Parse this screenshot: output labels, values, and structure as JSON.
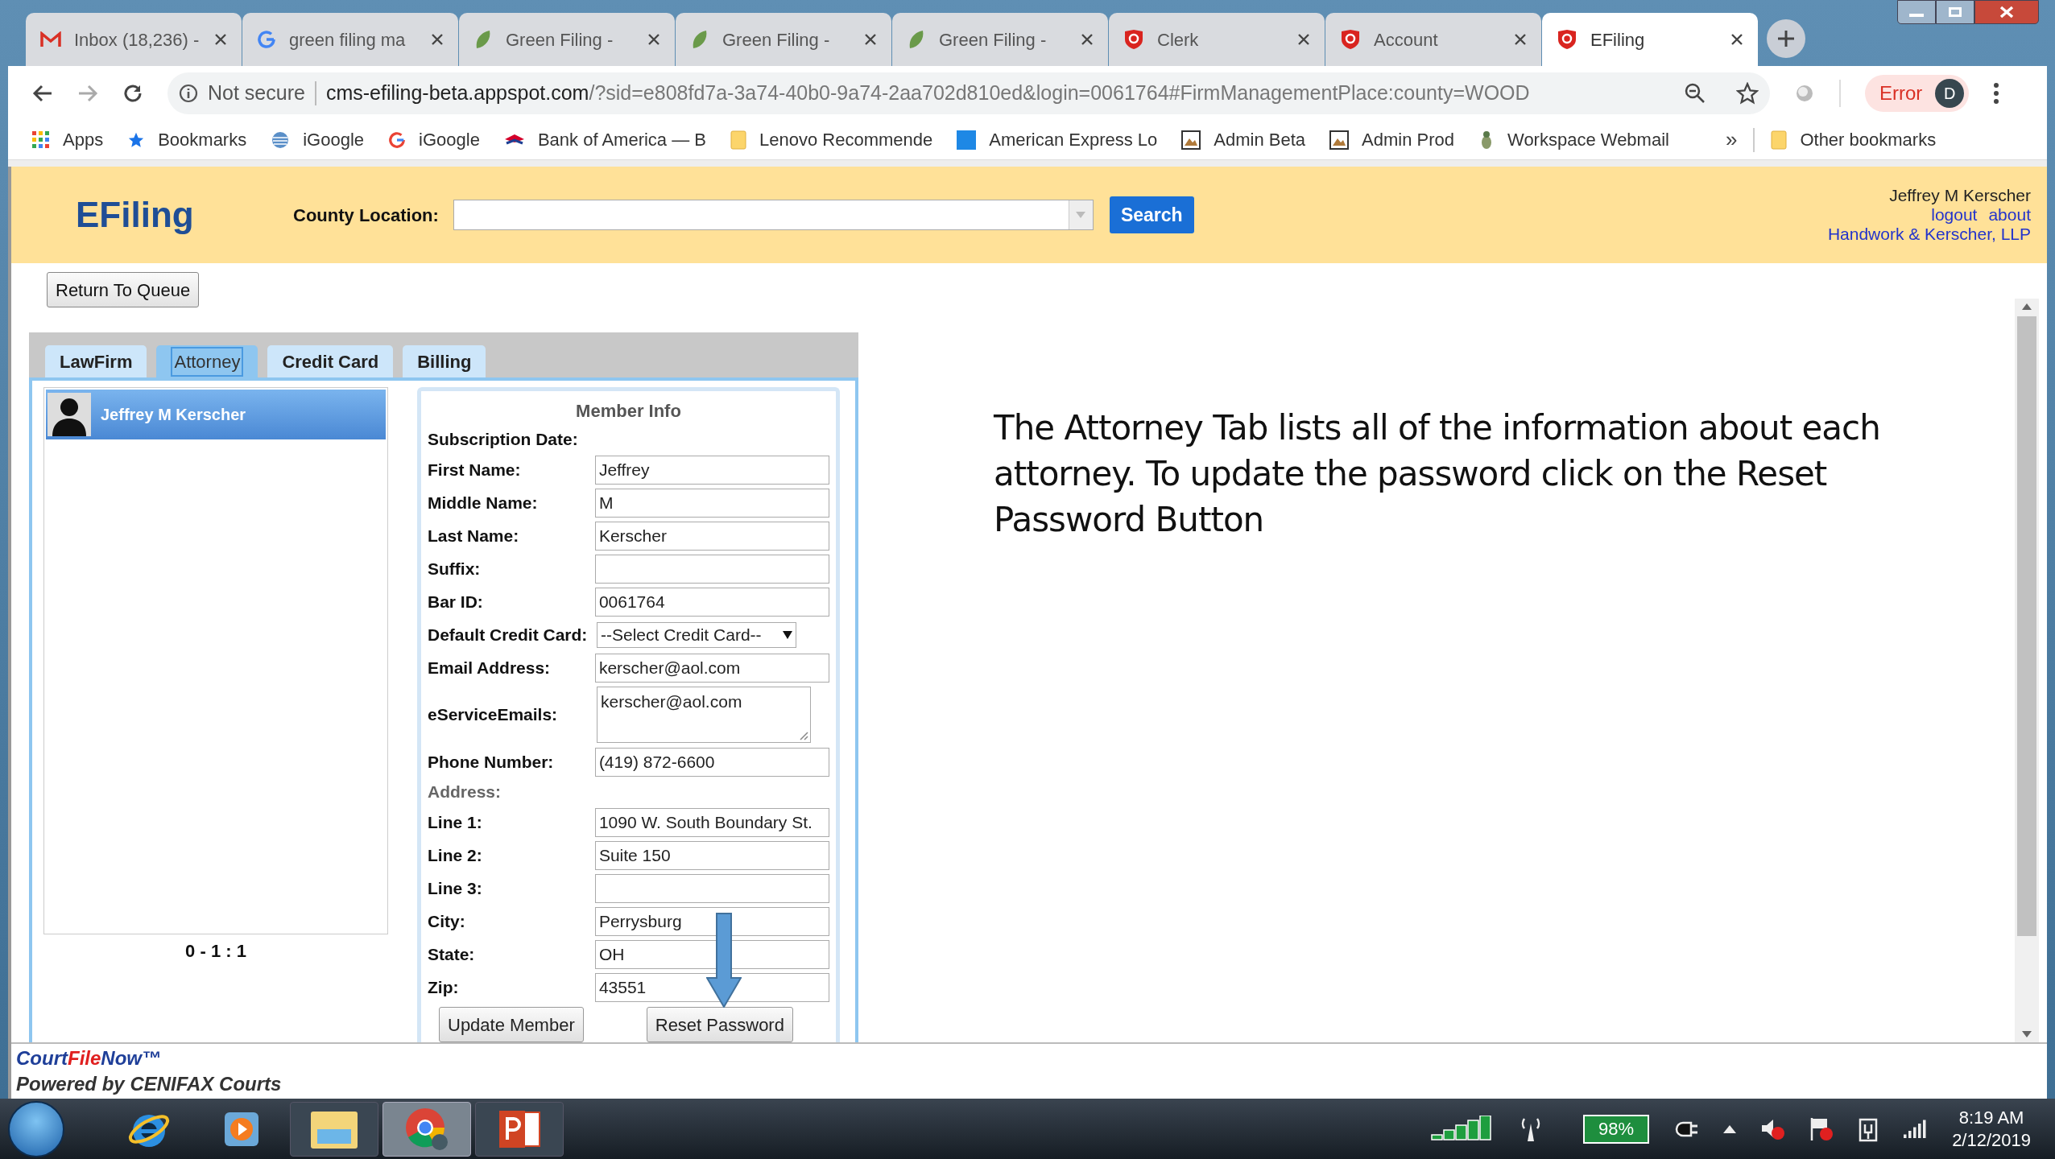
{
  "browser": {
    "tabs": [
      {
        "title": "Inbox (18,236) -",
        "kind": "mail",
        "selected": false
      },
      {
        "title": "green filing ma",
        "kind": "google",
        "selected": false
      },
      {
        "title": "Green Filing -",
        "kind": "leaf",
        "selected": false
      },
      {
        "title": "Green Filing -",
        "kind": "leaf",
        "selected": false
      },
      {
        "title": "Green Filing -",
        "kind": "leaf",
        "selected": false
      },
      {
        "title": "Clerk",
        "kind": "court",
        "selected": false
      },
      {
        "title": "Account",
        "kind": "court",
        "selected": false
      },
      {
        "title": "EFiling",
        "kind": "court",
        "selected": true
      }
    ],
    "security": "Not secure",
    "url_host": "cms-efiling-beta.appspot.com",
    "url_rest": "/?sid=e808fd7a-3a74-40b0-9a74-2aa702d810ed&login=0061764#FirmManagementPlace:county=WOOD",
    "profile_status": "Error",
    "profile_initial": "D",
    "bookmarks": [
      {
        "title": "Apps",
        "kind": "apps"
      },
      {
        "title": "Bookmarks",
        "kind": "star"
      },
      {
        "title": "iGoogle",
        "kind": "globe"
      },
      {
        "title": "iGoogle",
        "kind": "google"
      },
      {
        "title": "Bank of America — B",
        "kind": "flag"
      },
      {
        "title": "Lenovo Recommende",
        "kind": "folder"
      },
      {
        "title": "American Express Lo",
        "kind": "square"
      },
      {
        "title": "Admin Beta",
        "kind": "image"
      },
      {
        "title": "Admin Prod",
        "kind": "image"
      },
      {
        "title": "Workspace Webmail",
        "kind": "bug"
      }
    ],
    "bookmarks_overflow": "»",
    "other_bookmarks": "Other bookmarks"
  },
  "app": {
    "title": "EFiling",
    "county_label": "County Location:",
    "search_button": "Search",
    "user_name": "Jeffrey M Kerscher",
    "user_links": [
      "logout",
      "about"
    ],
    "firm": "Handwork & Kerscher, LLP"
  },
  "return_button": "Return To Queue",
  "tabs": [
    {
      "label": "LawFirm",
      "selected": false
    },
    {
      "label": "Attorney",
      "selected": true
    },
    {
      "label": "Credit Card",
      "selected": false
    },
    {
      "label": "Billing",
      "selected": false
    }
  ],
  "attorneys": [
    {
      "name": "Jeffrey M Kerscher",
      "selected": true
    }
  ],
  "pager": "0 - 1 : 1",
  "member_info": {
    "title": "Member Info",
    "fields": [
      {
        "label": "Subscription Date:",
        "kind": "text"
      },
      {
        "label": "First Name:",
        "kind": "input",
        "value": "Jeffrey"
      },
      {
        "label": "Middle Name:",
        "kind": "input",
        "value": "M"
      },
      {
        "label": "Last Name:",
        "kind": "input",
        "value": "Kerscher"
      },
      {
        "label": "Suffix:",
        "kind": "input"
      },
      {
        "label": "Bar ID:",
        "kind": "input",
        "value": "0061764"
      },
      {
        "label": "Default Credit Card:",
        "kind": "select",
        "value": "--Select Credit Card--"
      },
      {
        "label": "Email Address:",
        "kind": "input",
        "value": "kerscher@aol.com"
      },
      {
        "label": "eServiceEmails:",
        "kind": "textarea",
        "value": "kerscher@aol.com"
      },
      {
        "label": "Phone Number:",
        "kind": "input",
        "value": "(419) 872-6600"
      },
      {
        "label": "Address:",
        "kind": "section"
      },
      {
        "label": "Line 1:",
        "kind": "input",
        "value": "1090 W. South Boundary St."
      },
      {
        "label": "Line 2:",
        "kind": "input",
        "value": "Suite 150"
      },
      {
        "label": "Line 3:",
        "kind": "input"
      },
      {
        "label": "City:",
        "kind": "input",
        "value": "Perrysburg"
      },
      {
        "label": "State:",
        "kind": "input",
        "value": "OH"
      },
      {
        "label": "Zip:",
        "kind": "input",
        "value": "43551"
      }
    ],
    "buttons": [
      "Update Member",
      "Reset Password"
    ]
  },
  "annotation": "The Attorney Tab lists all of the information about each attorney. To update the password click on the Reset Password Button",
  "footer": {
    "brand_start": "Court",
    "brand_accent": "File",
    "brand_end": "Now™",
    "powered": "Powered by CENIFAX Courts"
  },
  "taskbar": {
    "apps": [
      {
        "kind": "ie",
        "selected": false
      },
      {
        "kind": "media",
        "selected": false
      },
      {
        "kind": "explorer",
        "selected": false
      },
      {
        "kind": "chrome",
        "selected": true
      },
      {
        "kind": "powerpoint",
        "selected": false
      }
    ],
    "battery": "98%",
    "time": "8:19 AM",
    "date": "2/12/2019"
  }
}
